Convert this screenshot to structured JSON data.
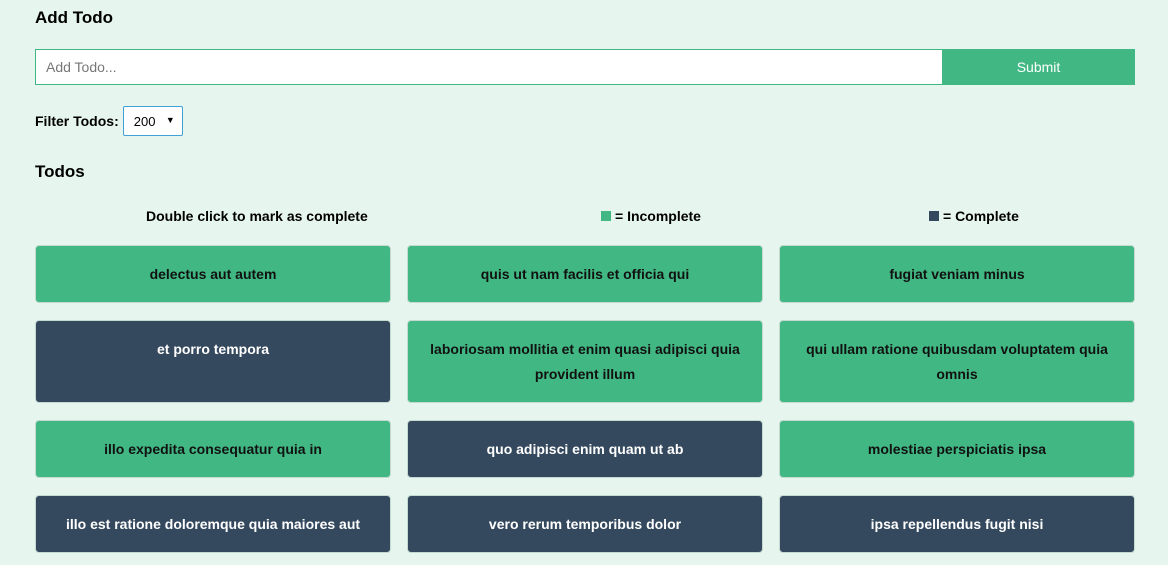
{
  "add": {
    "title": "Add Todo",
    "placeholder": "Add Todo...",
    "submit_label": "Submit"
  },
  "filter": {
    "label": "Filter Todos:",
    "selected": "200"
  },
  "todos_section": {
    "title": "Todos"
  },
  "legend": {
    "hint": "Double click to mark as complete",
    "incomplete_label": "= Incomplete",
    "complete_label": "= Complete",
    "incomplete_color": "#41b883",
    "complete_color": "#35495e"
  },
  "todos": [
    {
      "title": "delectus aut autem",
      "completed": false
    },
    {
      "title": "quis ut nam facilis et officia qui",
      "completed": false
    },
    {
      "title": "fugiat veniam minus",
      "completed": false
    },
    {
      "title": "et porro tempora",
      "completed": true
    },
    {
      "title": "laboriosam mollitia et enim quasi adipisci quia provident illum",
      "completed": false
    },
    {
      "title": "qui ullam ratione quibusdam voluptatem quia omnis",
      "completed": false
    },
    {
      "title": "illo expedita consequatur quia in",
      "completed": false
    },
    {
      "title": "quo adipisci enim quam ut ab",
      "completed": true
    },
    {
      "title": "molestiae perspiciatis ipsa",
      "completed": false
    },
    {
      "title": "illo est ratione doloremque quia maiores aut",
      "completed": true
    },
    {
      "title": "vero rerum temporibus dolor",
      "completed": true
    },
    {
      "title": "ipsa repellendus fugit nisi",
      "completed": true
    }
  ]
}
